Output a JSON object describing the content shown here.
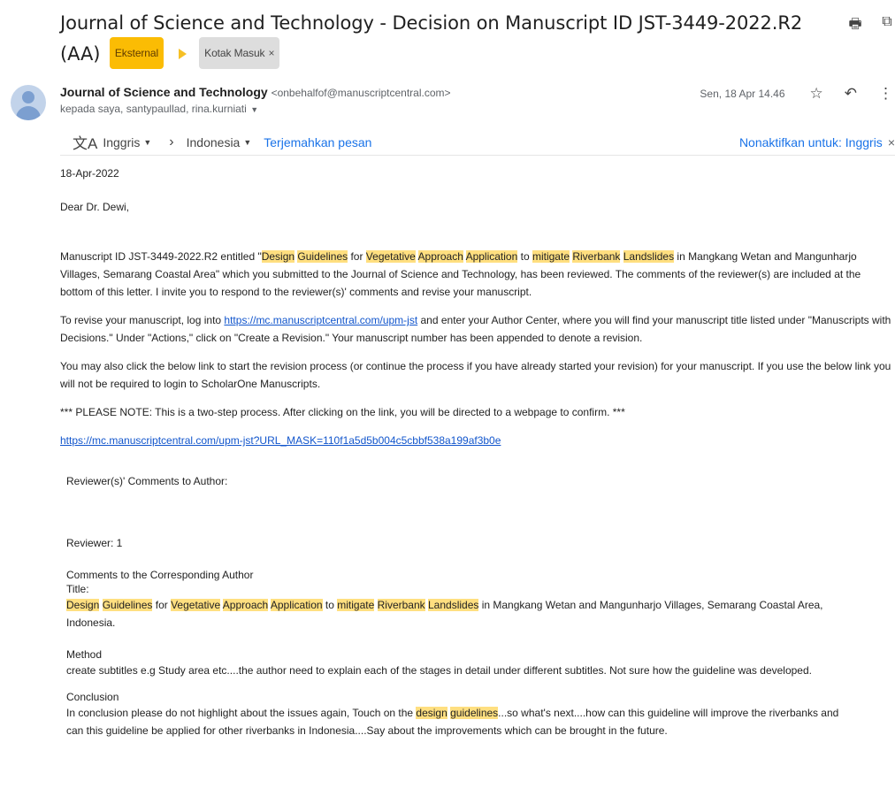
{
  "subject": {
    "line1": "Journal of Science and Technology - Decision on Manuscript ID JST-3449-2022.R2",
    "line2": "(AA)",
    "label_external": "Eksternal",
    "label_inbox": "Kotak Masuk",
    "remove_label": "×"
  },
  "top_icons": {
    "print": "print-icon",
    "open_new": "open-in-new-window-icon"
  },
  "sender": {
    "name": "Journal of Science and Technology",
    "email": "<onbehalfof@manuscriptcentral.com>",
    "recipients": "kepada saya, santypaullad, rina.kurniati"
  },
  "meta": {
    "date": "Sen, 18 Apr 14.46"
  },
  "translate": {
    "from_lang": "Inggris",
    "to_lang": "Indonesia",
    "translate_link": "Terjemahkan pesan",
    "disable": "Nonaktifkan untuk: Inggris",
    "close": "×"
  },
  "body": {
    "date": "18-Apr-2022",
    "greeting": "Dear Dr. Dewi,",
    "p1_start": "Manuscript ID JST-3449-2022.R2 entitled \"",
    "p1_end": " in Mangkang Wetan and Mangunharjo Villages, Semarang Coastal Area\" which you submitted to the Journal of Science and Technology, has been reviewed.  The comments of the reviewer(s) are included at the bottom of this letter. I invite you to respond to the reviewer(s)' comments and revise your manuscript.",
    "title_words": {
      "w1": "Design",
      "w2": "Guidelines",
      "for": " for ",
      "w3": "Vegetative",
      "w4": "Approach",
      "w5": "Application",
      "to": " to ",
      "w6": "mitigate",
      "w7": "Riverbank",
      "w8": "Landslides"
    },
    "p2_start": "To revise your manuscript, log into ",
    "p2_link": "https://mc.manuscriptcentral.com/upm-jst",
    "p2_end": " and enter your Author Center, where you will find your manuscript title listed under \"Manuscripts with Decisions.\"  Under \"Actions,\" click on \"Create a Revision.\"  Your manuscript number has been appended to denote a revision.",
    "p3": "You may also click the below link to start the revision process (or continue the process if you have already started your revision) for your manuscript. If you use the below link you will not be required to login to ScholarOne Manuscripts.",
    "p4": "*** PLEASE NOTE: This is a two-step process. After clicking on the link, you will be directed to a webpage to confirm. ***",
    "revision_link": "https://mc.manuscriptcentral.com/upm-jst?URL_MASK=110f1a5d5b004c5cbbf538a199af3b0e",
    "reviewer_comments_heading": "Reviewer(s)' Comments to Author:",
    "reviewer_label": "Reviewer: 1",
    "comments_heading": "Comments to the Corresponding Author",
    "title_label": "Title:",
    "title_end": " in Mangkang Wetan and Mangunharjo Villages, Semarang Coastal Area, Indonesia.",
    "method_heading": "Method",
    "method_text": "create subtitles e.g Study area etc....the author need to explain each of the stages in detail under different subtitles. Not sure how the guideline was developed.",
    "conclusion_heading": "Conclusion",
    "conclusion_start": "In conclusion please do not highlight about the issues again, Touch on the ",
    "conclusion_hl1": "design",
    "conclusion_hl2": "guidelines",
    "conclusion_end": "...so what's next....how can this guideline will improve the riverbanks and can this guideline be applied for other riverbanks in Indonesia....Say about the improvements which can be brought in the future."
  },
  "colors": {
    "highlight": "#ffdf80",
    "link": "#1155cc",
    "external_badge": "#fbbc04"
  }
}
